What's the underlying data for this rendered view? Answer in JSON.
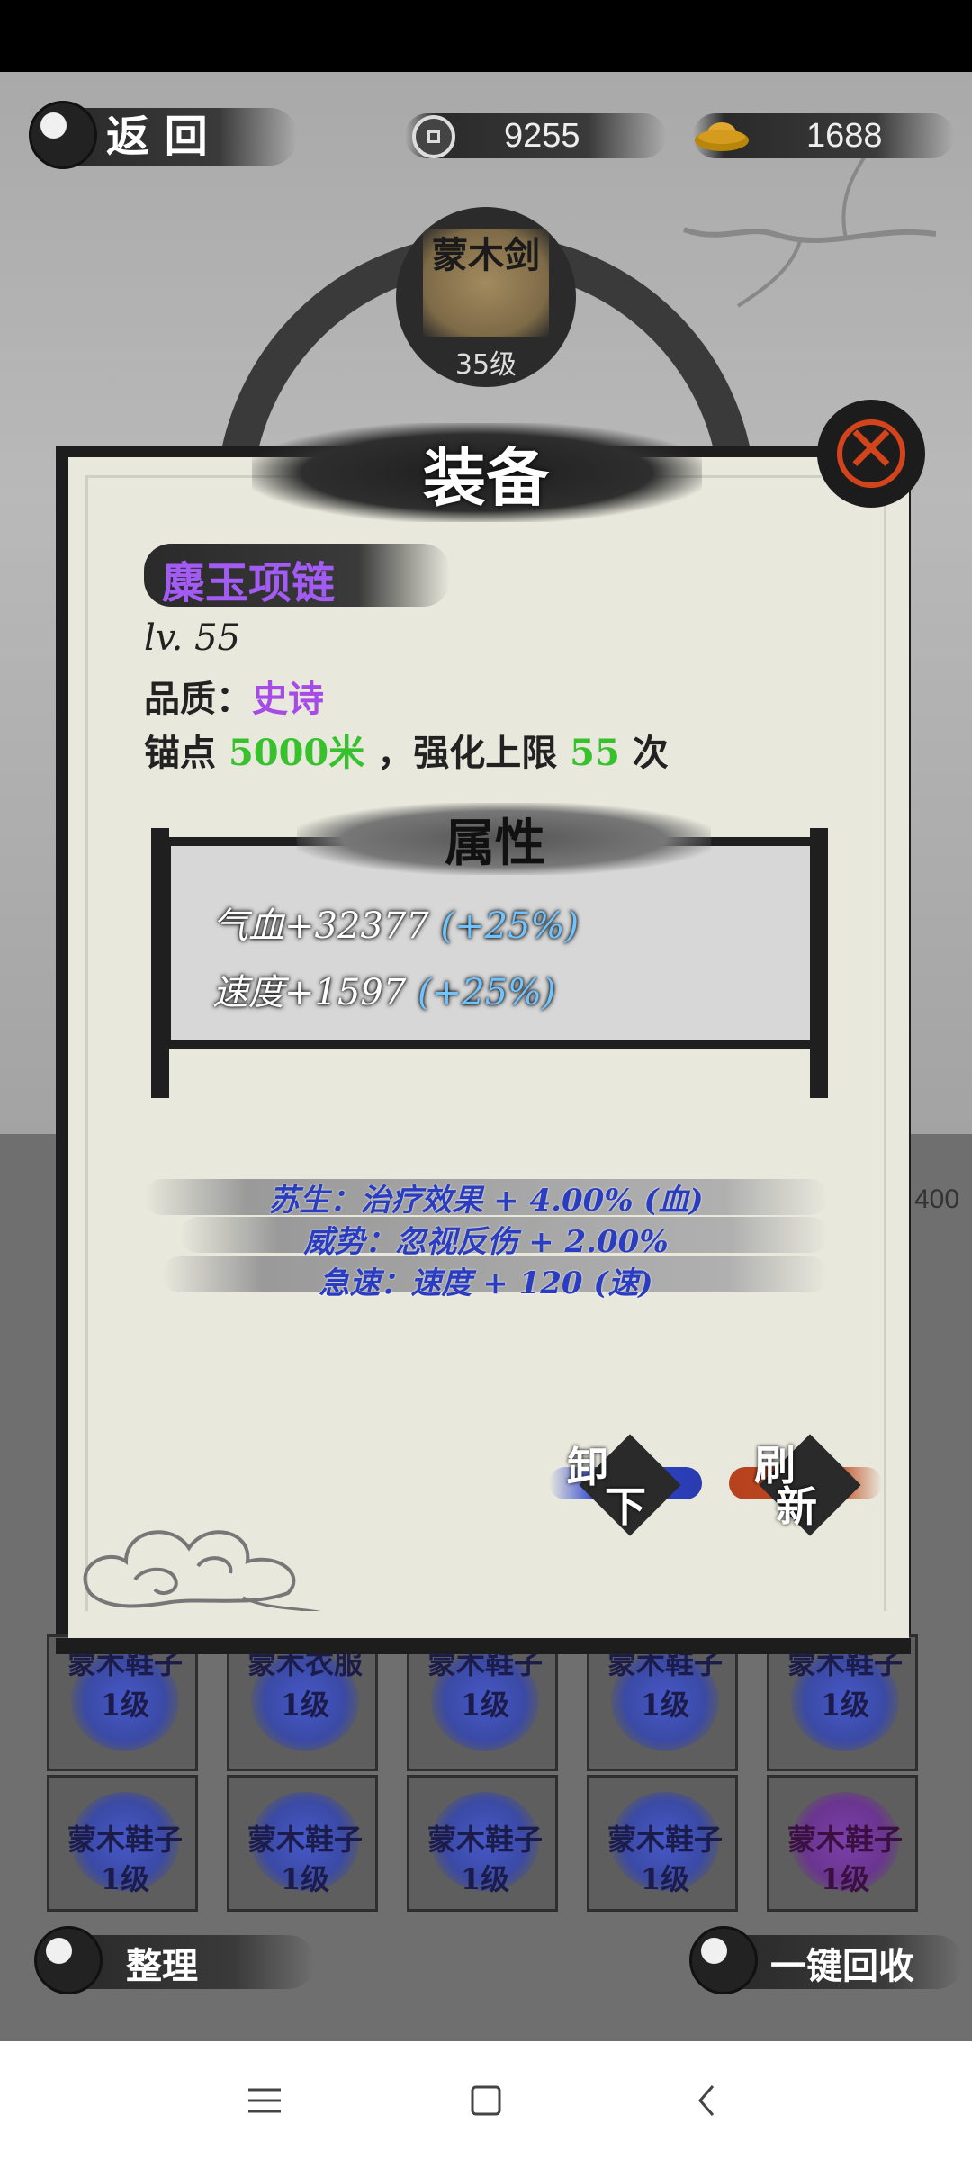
{
  "header": {
    "back_label": "返 回",
    "coins": "9255",
    "gold": "1688"
  },
  "equipped": {
    "name": "蒙木剑",
    "level": "35级"
  },
  "dialog": {
    "title": "装备",
    "item_name": "麋玉项链",
    "level_line": "lv. 55",
    "quality_label": "品质：",
    "quality_value": "史诗",
    "anchor_label": "锚点",
    "anchor_value": "5000米",
    "limit_label": "，强化上限",
    "limit_value": "55",
    "limit_unit": "次",
    "attributes_title": "属性",
    "attributes": [
      {
        "text": "气血+32377",
        "bonus": "(+25%)"
      },
      {
        "text": "速度+1597",
        "bonus": "(+25%)"
      }
    ],
    "sub_attributes": [
      "苏生：治疗效果 + 4.00% (血)",
      "威势：忽视反伤 + 2.00%",
      "急速：速度 + 120 (速)"
    ],
    "unequip_top": "卸",
    "unequip_bottom": "下",
    "refresh_top": "刷",
    "refresh_bottom": "新"
  },
  "inventory": {
    "row1": [
      {
        "name": "蒙木鞋子",
        "level": "1级"
      },
      {
        "name": "蒙木衣服",
        "level": "1级"
      },
      {
        "name": "蒙木鞋子",
        "level": "1级"
      },
      {
        "name": "蒙木鞋子",
        "level": "1级"
      },
      {
        "name": "蒙木鞋子",
        "level": "1级"
      }
    ],
    "row2": [
      {
        "name": "蒙木鞋子",
        "level": "1级"
      },
      {
        "name": "蒙木鞋子",
        "level": "1级"
      },
      {
        "name": "蒙木鞋子",
        "level": "1级"
      },
      {
        "name": "蒙木鞋子",
        "level": "1级"
      },
      {
        "name": "蒙木鞋子",
        "level": "1级"
      }
    ],
    "side_number": "400"
  },
  "footer": {
    "sort_label": "整理",
    "recycle_label": "一键回收"
  },
  "colors": {
    "epic_purple": "#a64be5",
    "highlight_green": "#37c12c",
    "close_red": "#d2441c",
    "sub_attr_blue": "#2a3cbf"
  },
  "icons": [
    "yin-yang-icon",
    "copper-coin-icon",
    "gold-ingot-icon",
    "close-icon",
    "cloud-icon",
    "menu-icon",
    "home-icon",
    "back-icon"
  ]
}
